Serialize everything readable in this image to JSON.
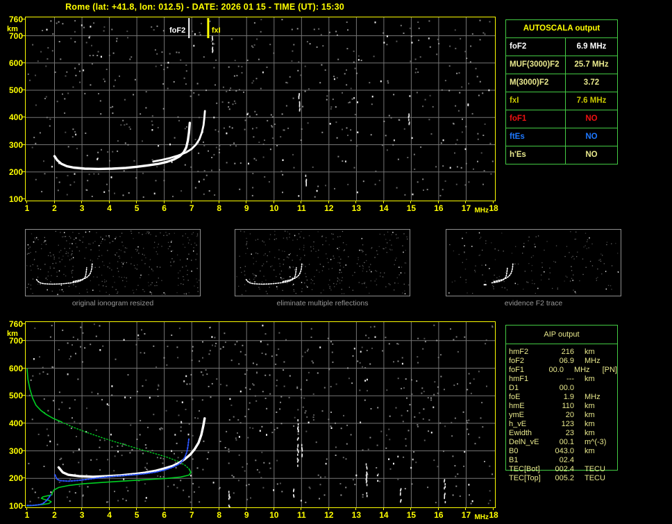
{
  "title": "Rome (lat: +41.8, lon: 012.5) - DATE: 2026 01 15 - TIME (UT): 15:30",
  "colors": {
    "axis": "#ffff00",
    "grid": "#757575",
    "noise_gray": "#a8a8a8",
    "trace_white": "#ffffff",
    "trace_blue": "#2b55ff",
    "trace_green": "#00d022",
    "table_border": "#44cc44",
    "pale_yellow": "#e8e88c",
    "gold": "#c8c800",
    "red": "#ee1111",
    "blue": "#1e78ff",
    "caption_gray": "#9a9a9a"
  },
  "plots": {
    "top": {
      "x_ticks": [
        1,
        2,
        3,
        4,
        5,
        6,
        7,
        8,
        9,
        10,
        11,
        12,
        13,
        14,
        15,
        16,
        17,
        18
      ],
      "y_ticks": [
        760,
        700,
        600,
        500,
        400,
        300,
        200,
        100
      ],
      "x_unit": "MHz",
      "y_unit": "km",
      "markers": [
        {
          "label": "foF2",
          "freq": 6.9,
          "color": "#ffffff",
          "width": 2,
          "anchor": "end"
        },
        {
          "label": "fxI",
          "freq": 7.6,
          "color": "#ffff00",
          "width": 3,
          "anchor": "start"
        }
      ],
      "noise": {
        "seed": 1337,
        "gray": 520,
        "white": 55
      },
      "streaks": [
        [
          10.9,
          430,
          495
        ],
        [
          7.75,
          640,
          700
        ],
        [
          14.9,
          380,
          420
        ],
        [
          11.15,
          150,
          190
        ]
      ],
      "traces": [
        {
          "name": "o-mode-trace",
          "color": "#ffffff",
          "width": 3.4,
          "points": [
            [
              2.0,
              258
            ],
            [
              2.1,
              243
            ],
            [
              2.25,
              230
            ],
            [
              2.45,
              221
            ],
            [
              2.7,
              216
            ],
            [
              3.1,
              212
            ],
            [
              3.6,
              211
            ],
            [
              4.1,
              212
            ],
            [
              4.6,
              215
            ],
            [
              5.0,
              219
            ],
            [
              5.4,
              224
            ],
            [
              5.8,
              230
            ],
            [
              6.1,
              237
            ],
            [
              6.35,
              246
            ],
            [
              6.55,
              257
            ],
            [
              6.7,
              271
            ],
            [
              6.8,
              290
            ],
            [
              6.86,
              315
            ],
            [
              6.9,
              345
            ],
            [
              6.93,
              380
            ]
          ]
        },
        {
          "name": "x-mode-trace",
          "color": "#ffffff",
          "width": 2.8,
          "points": [
            [
              5.6,
              238
            ],
            [
              5.9,
              244
            ],
            [
              6.2,
              251
            ],
            [
              6.5,
              260
            ],
            [
              6.8,
              272
            ],
            [
              7.0,
              285
            ],
            [
              7.15,
              300
            ],
            [
              7.28,
              320
            ],
            [
              7.37,
              345
            ],
            [
              7.43,
              372
            ],
            [
              7.46,
              400
            ],
            [
              7.48,
              424
            ]
          ]
        }
      ]
    },
    "bottom": {
      "x_ticks": [
        1,
        2,
        3,
        4,
        5,
        6,
        7,
        8,
        9,
        10,
        11,
        12,
        13,
        14,
        15,
        16,
        17,
        18
      ],
      "y_ticks": [
        760,
        700,
        600,
        500,
        400,
        300,
        200,
        100
      ],
      "x_unit": "MHz",
      "y_unit": "km",
      "markers": [],
      "noise": {
        "seed": 9001,
        "gray": 560,
        "white": 60
      },
      "streaks": [
        [
          10.85,
          250,
          415
        ],
        [
          10.7,
          128,
          168
        ],
        [
          11.0,
          285,
          350
        ],
        [
          13.35,
          135,
          255
        ],
        [
          16.2,
          118,
          200
        ],
        [
          8.35,
          100,
          158
        ],
        [
          14.6,
          120,
          180
        ]
      ],
      "traces": [
        {
          "name": "profile-topside-green",
          "color": "#00d022",
          "width": 1.6,
          "points": [
            [
              1.0,
              598
            ],
            [
              1.03,
              560
            ],
            [
              1.1,
              525
            ],
            [
              1.2,
              492
            ],
            [
              1.33,
              465
            ],
            [
              1.5,
              447
            ],
            [
              1.7,
              432
            ],
            [
              1.95,
              418
            ],
            [
              2.25,
              405
            ]
          ]
        },
        {
          "name": "profile-f1-region-green",
          "color": "#00d022",
          "width": 1.4,
          "dash": "1.5 2.6",
          "points": [
            [
              2.25,
              405
            ],
            [
              2.7,
              385
            ],
            [
              3.2,
              366
            ],
            [
              3.7,
              349
            ],
            [
              4.2,
              333
            ],
            [
              4.7,
              318
            ],
            [
              5.2,
              303
            ],
            [
              5.7,
              289
            ],
            [
              6.1,
              277
            ],
            [
              6.5,
              262
            ],
            [
              6.75,
              248
            ],
            [
              6.9,
              235
            ]
          ]
        },
        {
          "name": "profile-bottomside-green",
          "color": "#00d022",
          "width": 1.6,
          "points": [
            [
              6.9,
              235
            ],
            [
              6.97,
              222
            ],
            [
              6.9,
              212
            ],
            [
              6.6,
              205
            ],
            [
              6.1,
              200
            ],
            [
              5.4,
              196
            ],
            [
              4.6,
              191
            ],
            [
              3.8,
              186
            ],
            [
              3.0,
              180
            ],
            [
              2.5,
              174
            ],
            [
              2.15,
              167
            ],
            [
              1.98,
              158
            ],
            [
              1.92,
              148
            ],
            [
              1.9,
              140
            ],
            [
              1.75,
              137
            ],
            [
              1.58,
              133
            ],
            [
              1.52,
              128
            ],
            [
              1.62,
              124
            ],
            [
              1.8,
              120
            ],
            [
              1.88,
              115
            ],
            [
              1.8,
              109
            ],
            [
              1.55,
              105
            ],
            [
              1.25,
              102
            ],
            [
              1.0,
              100
            ]
          ]
        },
        {
          "name": "ionogram-white-trace",
          "color": "#ffffff",
          "width": 3.4,
          "points": [
            [
              2.15,
              240
            ],
            [
              2.3,
              222
            ],
            [
              2.5,
              213
            ],
            [
              2.9,
              208
            ],
            [
              3.4,
              206
            ],
            [
              3.9,
              208
            ],
            [
              4.4,
              211
            ],
            [
              4.9,
              216
            ],
            [
              5.3,
              221
            ],
            [
              5.7,
              228
            ],
            [
              6.0,
              236
            ],
            [
              6.3,
              245
            ],
            [
              6.55,
              257
            ],
            [
              6.75,
              270
            ],
            [
              6.95,
              287
            ],
            [
              7.1,
              305
            ],
            [
              7.25,
              330
            ],
            [
              7.35,
              358
            ],
            [
              7.42,
              390
            ],
            [
              7.47,
              418
            ]
          ]
        },
        {
          "name": "restored-o-trace-blue",
          "color": "#2b55ff",
          "width": 2,
          "dash": "2 2",
          "points": [
            [
              2.02,
              213
            ],
            [
              2.08,
              198
            ],
            [
              2.2,
              192
            ],
            [
              2.5,
              190
            ],
            [
              2.9,
              193
            ],
            [
              3.3,
              198
            ],
            [
              3.7,
              203
            ],
            [
              4.1,
              207
            ],
            [
              4.5,
              210
            ],
            [
              4.9,
              213
            ],
            [
              5.3,
              217
            ],
            [
              5.7,
              223
            ],
            [
              6.0,
              230
            ],
            [
              6.3,
              240
            ],
            [
              6.5,
              250
            ],
            [
              6.65,
              262
            ],
            [
              6.75,
              277
            ],
            [
              6.82,
              295
            ],
            [
              6.86,
              315
            ],
            [
              6.9,
              347
            ]
          ]
        },
        {
          "name": "restored-base-blue",
          "color": "#2b55ff",
          "width": 2,
          "dash": "2 2",
          "points": [
            [
              1.0,
              102
            ],
            [
              1.2,
              102
            ],
            [
              1.4,
              104
            ],
            [
              1.55,
              107
            ],
            [
              1.65,
              114
            ],
            [
              1.73,
              122
            ],
            [
              1.8,
              131
            ],
            [
              1.86,
              140
            ]
          ]
        }
      ]
    }
  },
  "thumbnails": [
    {
      "caption": "original ionogram resized",
      "noise": {
        "seed": 111,
        "gray": 330,
        "white": 30
      },
      "min_freq": 0
    },
    {
      "caption": "eliminate multiple reflections",
      "noise": {
        "seed": 222,
        "gray": 300,
        "white": 26
      },
      "min_freq": 0
    },
    {
      "caption": "evidence F2 trace",
      "noise": {
        "seed": 333,
        "gray": 150,
        "white": 18
      },
      "min_freq": 5.2
    }
  ],
  "autoscala": {
    "title": "AUTOSCALA output",
    "rows": [
      {
        "label": "foF2",
        "value": "6.9 MHz",
        "color": "#ffffff"
      },
      {
        "label": "MUF(3000)F2",
        "value": "25.7 MHz",
        "color": "#e8e88c"
      },
      {
        "label": "M(3000)F2",
        "value": "3.72",
        "color": "#e8e88c"
      },
      {
        "label": "fxI",
        "value": "7.6 MHz",
        "color": "#c8c800"
      },
      {
        "label": "foF1",
        "value": "NO",
        "color": "#ee1111"
      },
      {
        "label": "ftEs",
        "value": "NO",
        "color": "#1e78ff"
      },
      {
        "label": "h'Es",
        "value": "NO",
        "color": "#e8e88c"
      }
    ]
  },
  "aip": {
    "title": "AIP output",
    "rows": [
      {
        "label": "hmF2",
        "value": "216",
        "unit": "km",
        "note": ""
      },
      {
        "label": "foF2",
        "value": "06.9",
        "unit": "MHz",
        "note": ""
      },
      {
        "label": "foF1",
        "value": "00.0",
        "unit": "MHz",
        "note": "[PN]"
      },
      {
        "label": "hmF1",
        "value": "---",
        "unit": "km",
        "note": ""
      },
      {
        "label": "D1",
        "value": "00.0",
        "unit": "",
        "note": ""
      },
      {
        "label": "foE",
        "value": "1.9",
        "unit": "MHz",
        "note": ""
      },
      {
        "label": "hmE",
        "value": "110",
        "unit": "km",
        "note": ""
      },
      {
        "label": "ymE",
        "value": "20",
        "unit": "km",
        "note": ""
      },
      {
        "label": "h_vE",
        "value": "123",
        "unit": "km",
        "note": ""
      },
      {
        "label": "Ewidth",
        "value": "23",
        "unit": "km",
        "note": ""
      },
      {
        "label": "DelN_vE",
        "value": "00.1",
        "unit": "m^(-3)",
        "note": ""
      },
      {
        "label": "B0",
        "value": "043.0",
        "unit": "km",
        "note": ""
      },
      {
        "label": "B1",
        "value": "02.4",
        "unit": "",
        "note": ""
      },
      {
        "label": "TEC[Bot]",
        "value": "002.4",
        "unit": "TECU",
        "note": ""
      },
      {
        "label": "TEC[Top]",
        "value": "005.2",
        "unit": "TECU",
        "note": ""
      }
    ]
  }
}
